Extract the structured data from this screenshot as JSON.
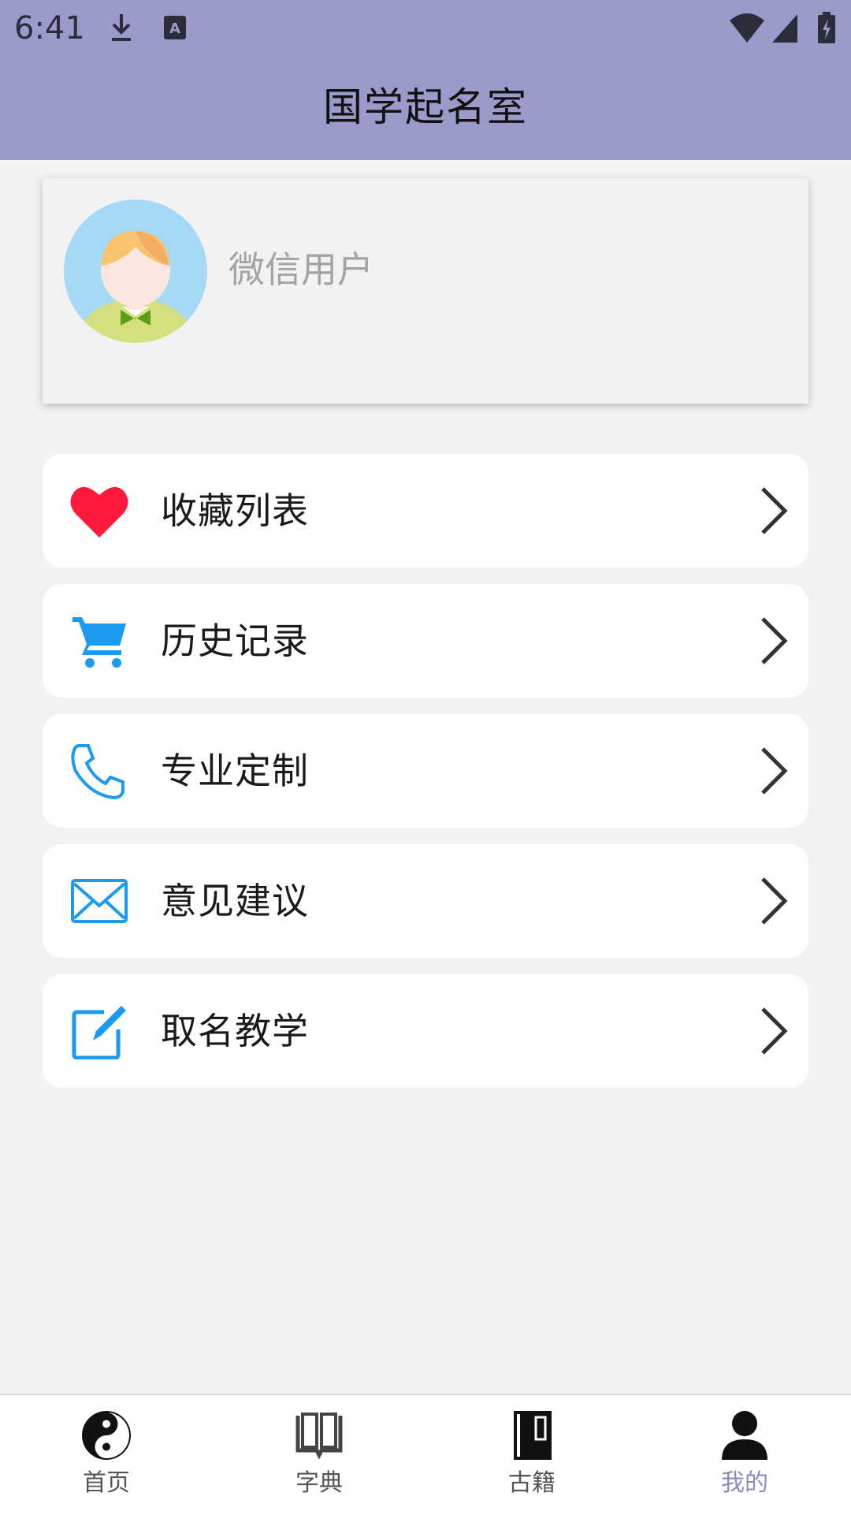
{
  "status_bar": {
    "time": "6:41"
  },
  "header": {
    "title": "国学起名室"
  },
  "profile": {
    "username": "微信用户"
  },
  "menu": {
    "items": [
      {
        "label": "收藏列表",
        "icon": "heart-icon",
        "icon_color": "#ff1a3c"
      },
      {
        "label": "历史记录",
        "icon": "cart-icon",
        "icon_color": "#1a9bf0"
      },
      {
        "label": "专业定制",
        "icon": "phone-icon",
        "icon_color": "#1a9bf0"
      },
      {
        "label": "意见建议",
        "icon": "mail-icon",
        "icon_color": "#1a9bf0"
      },
      {
        "label": "取名教学",
        "icon": "edit-icon",
        "icon_color": "#1a9bf0"
      }
    ]
  },
  "bottom_nav": {
    "items": [
      {
        "label": "首页",
        "icon": "yin-yang-icon"
      },
      {
        "label": "字典",
        "icon": "open-book-icon"
      },
      {
        "label": "古籍",
        "icon": "ancient-book-icon"
      },
      {
        "label": "我的",
        "icon": "user-icon"
      }
    ],
    "active_index": 3
  },
  "colors": {
    "header_bg": "#9a9acb",
    "page_bg": "#f2f2f2",
    "accent_blue": "#1a9bf0",
    "heart_red": "#ff1a3c",
    "nav_active": "#8b8bc3"
  }
}
